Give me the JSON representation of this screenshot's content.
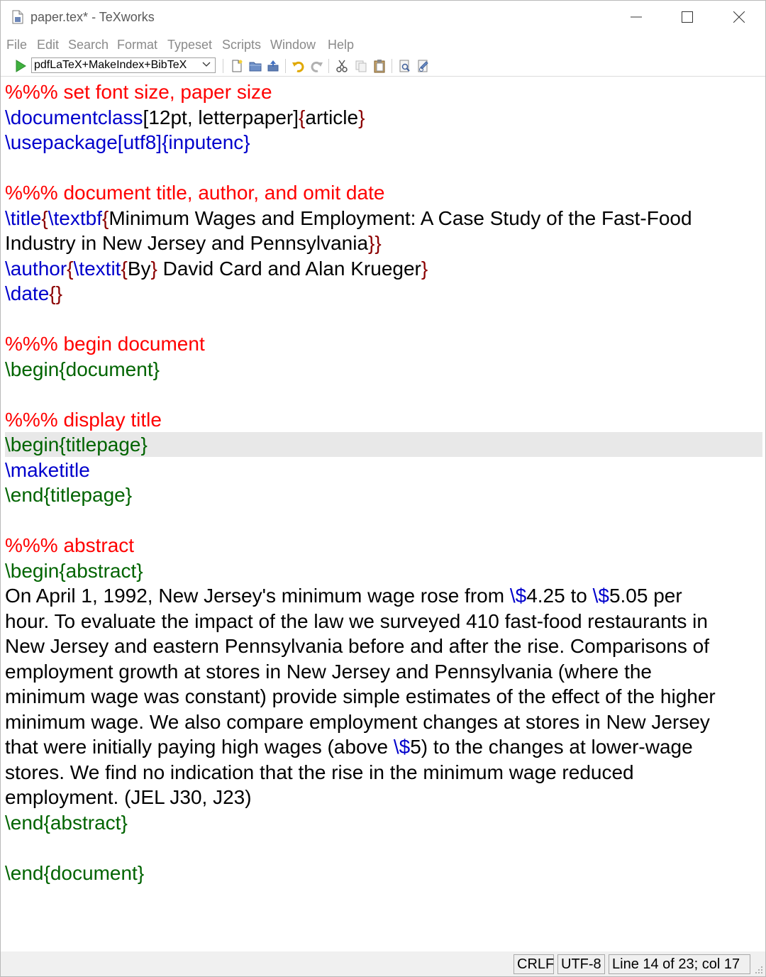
{
  "window": {
    "title": "paper.tex* - TeXworks",
    "controls": {
      "minimize": "minimize-icon",
      "maximize": "maximize-icon",
      "close": "close-icon"
    }
  },
  "menu": [
    "File",
    "Edit",
    "Search",
    "Format",
    "Typeset",
    "Scripts",
    "Window",
    "Help"
  ],
  "toolbar": {
    "run_icon": "play-icon",
    "engine": "pdfLaTeX+MakeIndex+BibTeX",
    "icons": [
      "new-file-icon",
      "open-folder-icon",
      "save-icon",
      "undo-icon",
      "redo-icon",
      "cut-icon",
      "copy-icon",
      "paste-icon",
      "find-icon",
      "replace-icon"
    ]
  },
  "editor": {
    "lines": [
      [
        {
          "t": "%%% set font size, paper size",
          "c": "cmt"
        }
      ],
      [
        {
          "t": "\\documentclass",
          "c": "cmd"
        },
        {
          "t": "[12pt, letterpaper]",
          "c": "txt"
        },
        {
          "t": "{",
          "c": "brace"
        },
        {
          "t": "article",
          "c": "txt"
        },
        {
          "t": "}",
          "c": "brace"
        }
      ],
      [
        {
          "t": "\\usepackage",
          "c": "cmd"
        },
        {
          "t": "[utf8]",
          "c": "cmd"
        },
        {
          "t": "{inputenc}",
          "c": "cmd"
        }
      ],
      [],
      [
        {
          "t": "%%% document title, author, and omit date",
          "c": "cmt"
        }
      ],
      [
        {
          "t": "\\title",
          "c": "cmd"
        },
        {
          "t": "{",
          "c": "brace"
        },
        {
          "t": "\\textbf",
          "c": "cmd"
        },
        {
          "t": "{",
          "c": "brace"
        },
        {
          "t": "Minimum Wages and Employment: A Case Study of the Fast-Food",
          "c": "txt"
        }
      ],
      [
        {
          "t": "Industry in New Jersey and Pennsylvania",
          "c": "txt"
        },
        {
          "t": "}}",
          "c": "brace"
        }
      ],
      [
        {
          "t": "\\author",
          "c": "cmd"
        },
        {
          "t": "{",
          "c": "brace"
        },
        {
          "t": "\\textit",
          "c": "cmd"
        },
        {
          "t": "{",
          "c": "brace"
        },
        {
          "t": "By",
          "c": "txt"
        },
        {
          "t": "}",
          "c": "brace"
        },
        {
          "t": " David Card and Alan Krueger",
          "c": "txt"
        },
        {
          "t": "}",
          "c": "brace"
        }
      ],
      [
        {
          "t": "\\date",
          "c": "cmd"
        },
        {
          "t": "{}",
          "c": "brace"
        }
      ],
      [],
      [
        {
          "t": "%%% begin document",
          "c": "cmt"
        }
      ],
      [
        {
          "t": "\\begin{document}",
          "c": "env"
        }
      ],
      [],
      [
        {
          "t": "%%% display title",
          "c": "cmt"
        }
      ],
      [
        {
          "t": "\\begin{titlepage}",
          "c": "env"
        }
      ],
      [
        {
          "t": "\\maketitle",
          "c": "cmd"
        }
      ],
      [
        {
          "t": "\\end{titlepage}",
          "c": "env"
        }
      ],
      [],
      [
        {
          "t": "%%% abstract",
          "c": "cmt"
        }
      ],
      [
        {
          "t": "\\begin{abstract}",
          "c": "env"
        }
      ],
      [
        {
          "t": "On April 1, 1992, New Jersey's minimum wage rose from ",
          "c": "txt"
        },
        {
          "t": "\\$",
          "c": "cmd"
        },
        {
          "t": "4.25 to ",
          "c": "txt"
        },
        {
          "t": "\\$",
          "c": "cmd"
        },
        {
          "t": "5.05 per",
          "c": "txt"
        }
      ],
      [
        {
          "t": "hour. To evaluate the impact of the law we surveyed 410 fast-food restaurants in",
          "c": "txt"
        }
      ],
      [
        {
          "t": "New Jersey and eastern Pennsylvania before and after the rise. Comparisons of",
          "c": "txt"
        }
      ],
      [
        {
          "t": "employment growth at stores in New Jersey and Pennsylvania (where the",
          "c": "txt"
        }
      ],
      [
        {
          "t": "minimum wage was constant) provide simple estimates of the effect of the higher",
          "c": "txt"
        }
      ],
      [
        {
          "t": "minimum wage. We also compare employment changes at stores in New Jersey",
          "c": "txt"
        }
      ],
      [
        {
          "t": "that were initially paying high wages (above ",
          "c": "txt"
        },
        {
          "t": "\\$",
          "c": "cmd"
        },
        {
          "t": "5) to the changes at lower-wage",
          "c": "txt"
        }
      ],
      [
        {
          "t": "stores. We find no indication that the rise in the minimum wage reduced",
          "c": "txt"
        }
      ],
      [
        {
          "t": "employment. (JEL J30, J23)",
          "c": "txt"
        }
      ],
      [
        {
          "t": "\\end{abstract}",
          "c": "env"
        }
      ],
      [],
      [
        {
          "t": "\\end{document}",
          "c": "env"
        }
      ]
    ],
    "highlighted_line_index": 14
  },
  "status": {
    "line_ending": "CRLF",
    "encoding": "UTF-8",
    "position": "Line 14 of 23; col 17"
  },
  "colors": {
    "comment": "#ff0000",
    "command": "#0000cc",
    "environment": "#006400",
    "brace": "#8b0000"
  }
}
